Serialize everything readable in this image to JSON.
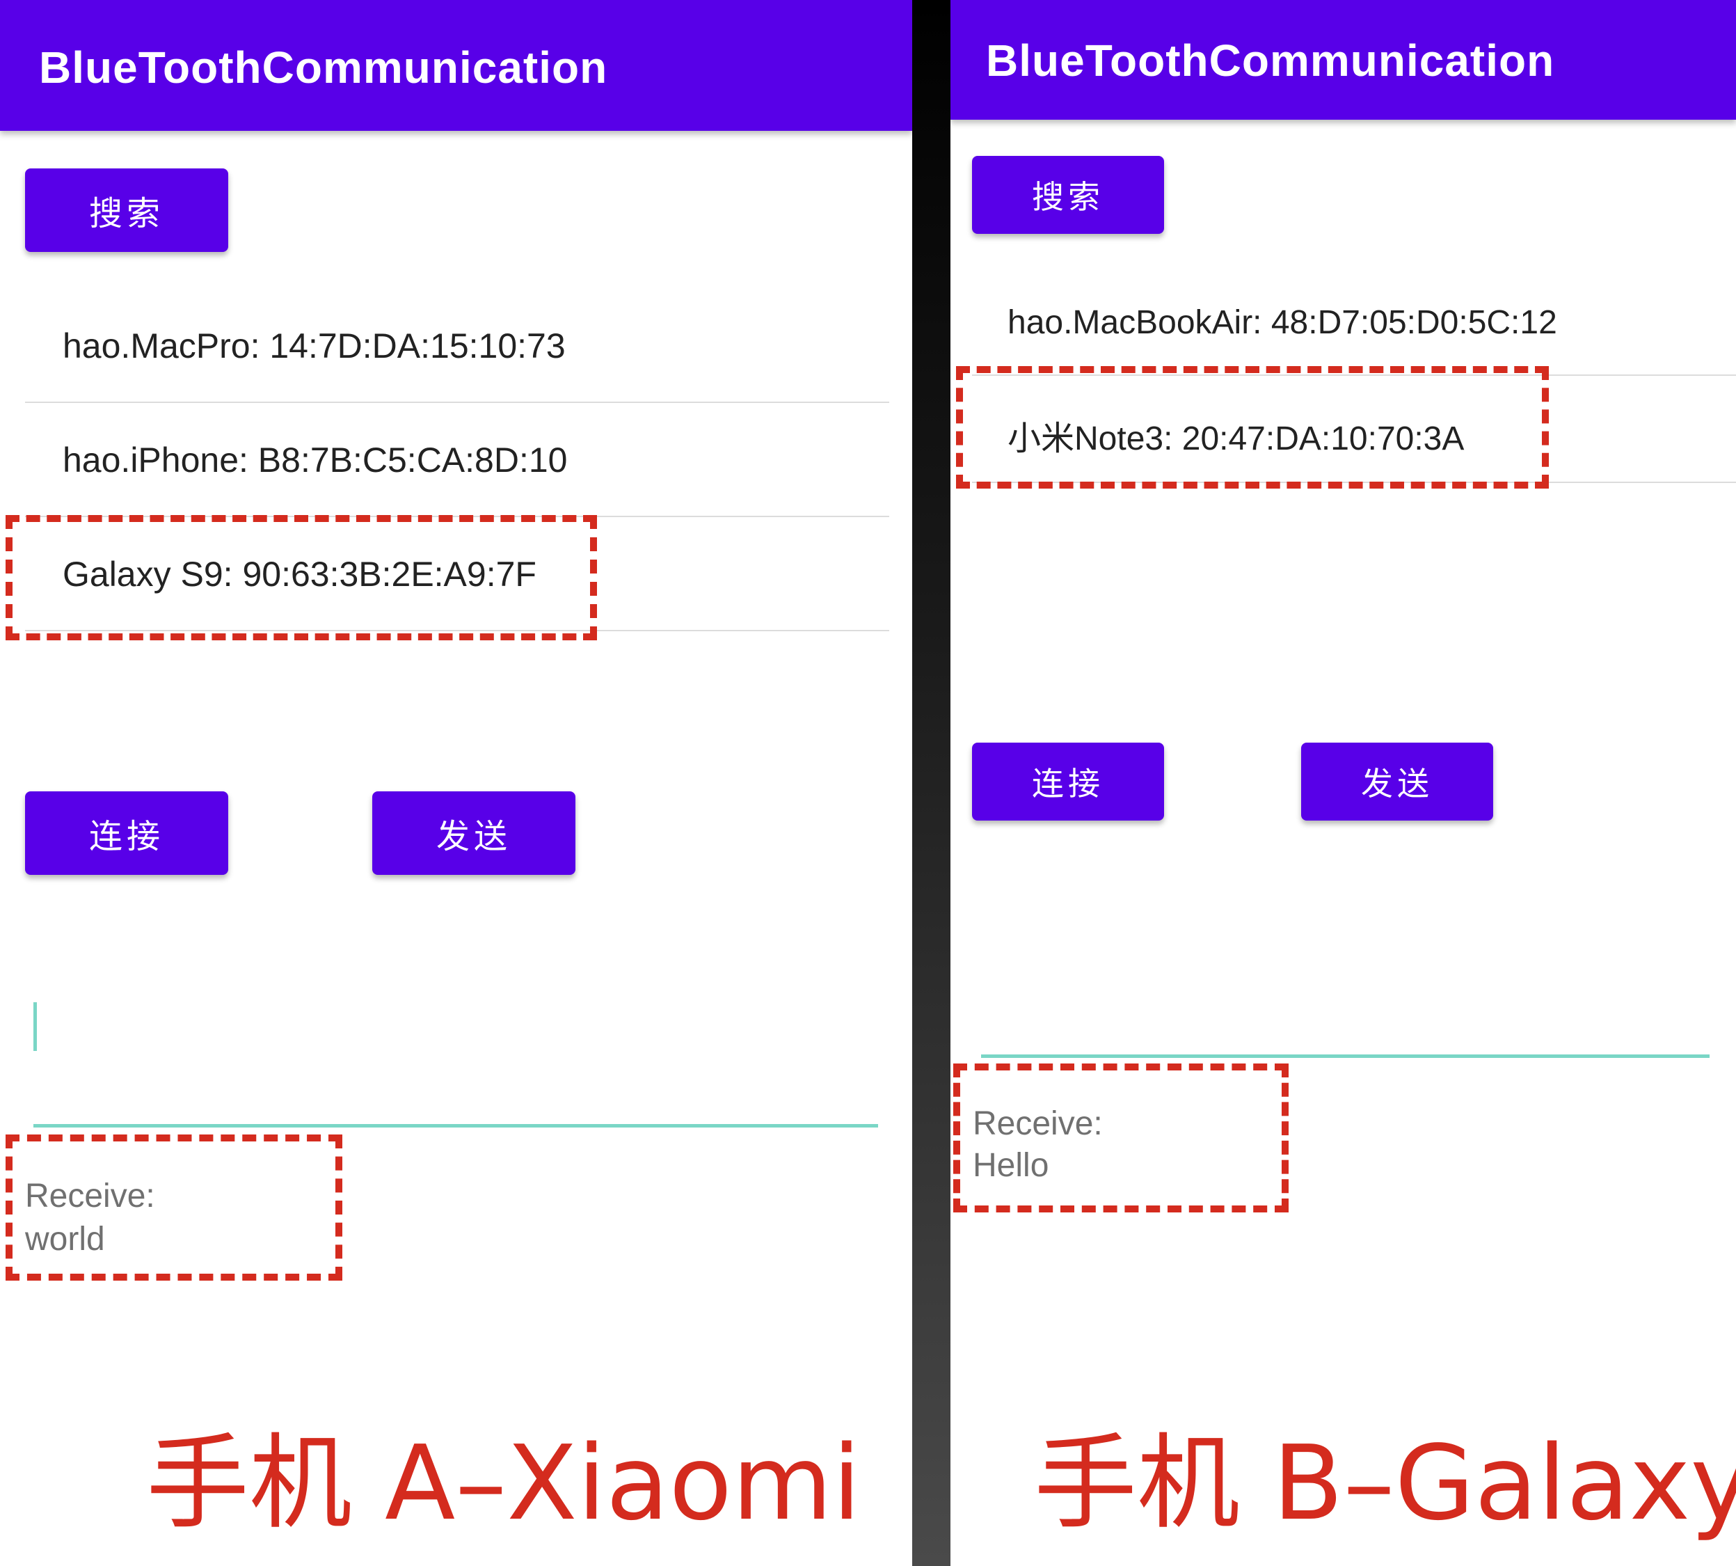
{
  "phone_a": {
    "app_title": "BlueToothCommunication",
    "search_button": "搜索",
    "connect_button": "连接",
    "send_button": "发送",
    "devices": [
      "hao.MacPro: 14:7D:DA:15:10:73",
      "hao.iPhone: B8:7B:C5:CA:8D:10",
      "Galaxy S9: 90:63:3B:2E:A9:7F"
    ],
    "message_input": "",
    "receive_label": "Receive:",
    "receive_value": "world",
    "caption": "手机 A–Xiaomi"
  },
  "phone_b": {
    "app_title": "BlueToothCommunication",
    "search_button": "搜索",
    "connect_button": "连接",
    "send_button": "发送",
    "devices": [
      "hao.MacBookAir: 48:D7:05:D0:5C:12",
      "小米Note3: 20:47:DA:10:70:3A"
    ],
    "message_input": "",
    "receive_label": "Receive:",
    "receive_value": "Hello",
    "caption": "手机 B–Galaxy"
  },
  "colors": {
    "primary": "#5800e8",
    "accent_line": "#7ad6c6",
    "highlight": "#d42b1e"
  }
}
